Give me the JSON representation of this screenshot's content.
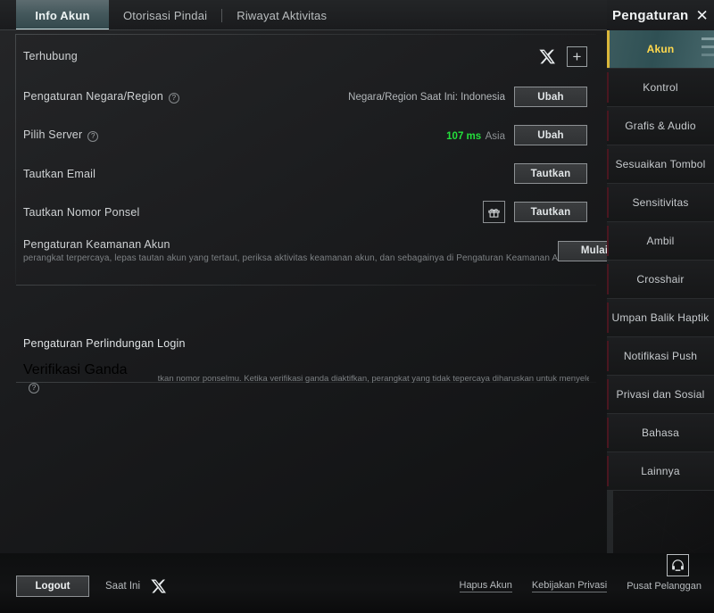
{
  "tabs": [
    {
      "label": "Info Akun",
      "active": true
    },
    {
      "label": "Otorisasi Pindai",
      "active": false
    },
    {
      "label": "Riwayat Aktivitas",
      "active": false
    }
  ],
  "sidebar": {
    "title": "Pengaturan",
    "close_icon": "✕",
    "items": [
      {
        "label": "Akun",
        "active": true
      },
      {
        "label": "Kontrol",
        "active": false
      },
      {
        "label": "Grafis & Audio",
        "active": false
      },
      {
        "label": "Sesuaikan Tombol",
        "active": false
      },
      {
        "label": "Sensitivitas",
        "active": false
      },
      {
        "label": "Ambil",
        "active": false
      },
      {
        "label": "Crosshair",
        "active": false
      },
      {
        "label": "Umpan Balik Haptik",
        "active": false
      },
      {
        "label": "Notifikasi Push",
        "active": false
      },
      {
        "label": "Privasi dan Sosial",
        "active": false
      },
      {
        "label": "Bahasa",
        "active": false
      },
      {
        "label": "Lainnya",
        "active": false
      }
    ]
  },
  "rows": {
    "connected": {
      "label": "Terhubung",
      "x_icon": "x-logo",
      "plus": "+"
    },
    "country": {
      "label": "Pengaturan Negara/Region",
      "hint": "?",
      "value": "Negara/Region Saat Ini: Indonesia",
      "button": "Ubah"
    },
    "server": {
      "label": "Pilih Server",
      "hint": "?",
      "ping": "107 ms",
      "region": "Asia",
      "button": "Ubah"
    },
    "email": {
      "label": "Tautkan Email",
      "button": "Tautkan"
    },
    "phone": {
      "label": "Tautkan Nomor Ponsel",
      "gift_icon": "gift-icon",
      "button": "Tautkan"
    },
    "security": {
      "label": "Pengaturan Keamanan Akun",
      "sub": "perangkat terpercaya, lepas tautan akun yang tertaut, periksa aktivitas keamanan akun, dan sebagainya di Pengaturan Keamanan A",
      "button": "Mulai"
    }
  },
  "section_login": {
    "title": "Pengaturan Perlindungan Login",
    "two_factor": {
      "label": "Verifikasi Ganda",
      "hint": "?",
      "desc": "tkan nomor ponselmu. Ketika verifikasi ganda diaktifkan, perangkat yang tidak tepercaya diharuskan untuk menyelesaikan"
    }
  },
  "bottom": {
    "logout": "Logout",
    "current_label": "Saat Ini",
    "current_icon": "x-logo",
    "links": [
      {
        "label": "Hapus Akun",
        "underline": true
      },
      {
        "label": "Kebijakan Privasi",
        "underline": true
      },
      {
        "label": "Pusat Pelanggan",
        "underline": false
      }
    ],
    "support_icon": "headset-icon"
  },
  "colors": {
    "accent_ping": "#24e03c",
    "accent_active_tab": "#cfe3e5",
    "accent_sidebar_active_text": "#ffd84d",
    "accent_sidebar_rail": "#4a1620"
  }
}
